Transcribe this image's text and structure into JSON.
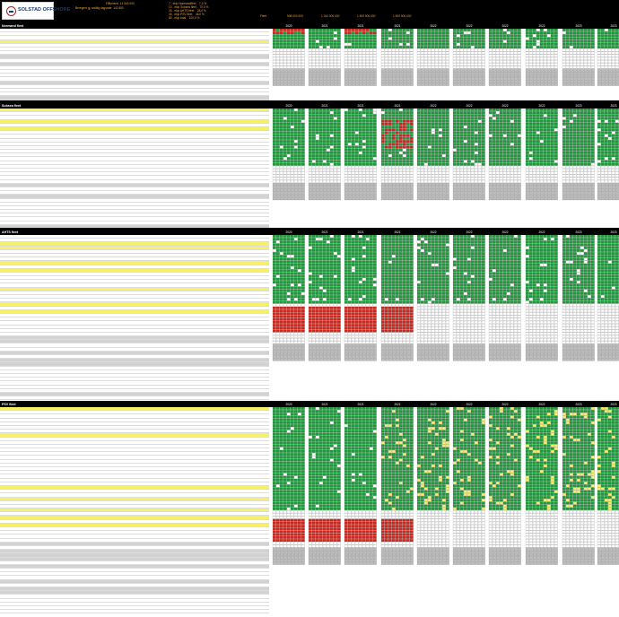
{
  "logo": {
    "text": "SOLSTAD OFFSHORE"
  },
  "header": {
    "lines": [
      {
        "label": "Flåteverdi",
        "value": "14 540 000"
      },
      {
        "label": "Beregnet gj. snittlig dagsrate",
        "value": "142 850"
      }
    ],
    "stats": [
      {
        "label": "7 - ekip Normandfleet",
        "value": "7,0 %"
      },
      {
        "label": "10 - ekip Subsea fleet",
        "value": "70,0 %"
      },
      {
        "label": "26 - ekip AHTS fleet",
        "value": "28,0 %"
      },
      {
        "label": "46 - ekip PSV fleet",
        "value": "46,0 %"
      },
      {
        "label": "89 - ekip total",
        "value": "100,0 %"
      }
    ],
    "totals_label": "Fleet",
    "totals": [
      "908 000 000",
      "1 244 000 000",
      "1 500 000 000",
      "1 500 000 000"
    ]
  },
  "years": [
    "2020",
    "2021",
    "2021",
    "2021",
    "2022",
    "2022",
    "2022",
    "2022",
    "2023",
    "2023"
  ],
  "sections": [
    {
      "id": "normand",
      "title": "Normand fleet"
    },
    {
      "id": "subsea",
      "title": "Subsea fleet"
    },
    {
      "id": "ahts",
      "title": "AHTS fleet"
    },
    {
      "id": "psv",
      "title": "PSV fleet"
    }
  ],
  "colors": {
    "green": "#1e9c3c",
    "red": "#d0261d",
    "yellow": "#f5ef6a",
    "grey": "#bdbdbd",
    "white": "#ffffff",
    "black": "#000000"
  }
}
